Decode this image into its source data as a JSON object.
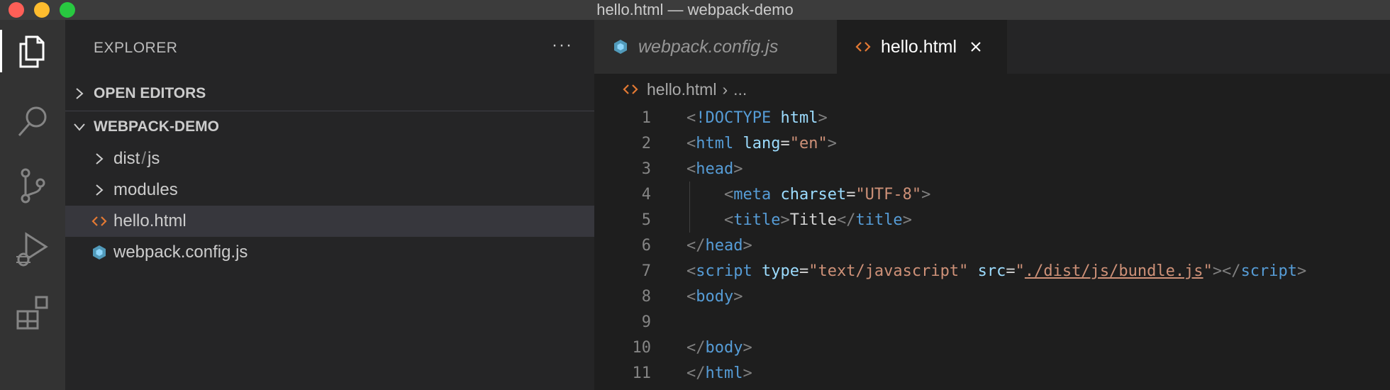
{
  "window": {
    "title": "hello.html — webpack-demo"
  },
  "colors": {
    "accent_orange": "#e37933",
    "js_config_blue": "#519aba",
    "tag_blue": "#569cd6",
    "attr_cyan": "#9cdcfe",
    "string_orange": "#ce9178"
  },
  "activity_bar": [
    {
      "name": "explorer",
      "icon": "files-icon",
      "active": true
    },
    {
      "name": "search",
      "icon": "search-icon"
    },
    {
      "name": "source-control",
      "icon": "source-control-icon"
    },
    {
      "name": "run-debug",
      "icon": "debug-icon"
    },
    {
      "name": "extensions",
      "icon": "extensions-icon"
    }
  ],
  "sidebar": {
    "header": "EXPLORER",
    "more": "···",
    "open_editors": "OPEN EDITORS",
    "project": "WEBPACK-DEMO",
    "tree": {
      "dist": "dist",
      "dist_sep": "/",
      "dist_child": "js",
      "modules": "modules",
      "hello": "hello.html",
      "webpack_config": "webpack.config.js"
    }
  },
  "tabs": {
    "webpack": "webpack.config.js",
    "hello": "hello.html"
  },
  "breadcrumb": {
    "file": "hello.html",
    "sep": "›",
    "rest": "..."
  },
  "editor": {
    "line_numbers": [
      "1",
      "2",
      "3",
      "4",
      "5",
      "6",
      "7",
      "8",
      "9",
      "10",
      "11"
    ],
    "lines": [
      [
        [
          "punct",
          "<"
        ],
        [
          "doctype",
          "!DOCTYPE"
        ],
        [
          "text",
          " "
        ],
        [
          "attr",
          "html"
        ],
        [
          "punct",
          ">"
        ]
      ],
      [
        [
          "punct",
          "<"
        ],
        [
          "tag",
          "html"
        ],
        [
          "text",
          " "
        ],
        [
          "attr",
          "lang"
        ],
        [
          "text",
          "="
        ],
        [
          "str",
          "\"en\""
        ],
        [
          "punct",
          ">"
        ]
      ],
      [
        [
          "punct",
          "<"
        ],
        [
          "tag",
          "head"
        ],
        [
          "punct",
          ">"
        ]
      ],
      [
        [
          "text",
          "    "
        ],
        [
          "punct",
          "<"
        ],
        [
          "tag",
          "meta"
        ],
        [
          "text",
          " "
        ],
        [
          "attr",
          "charset"
        ],
        [
          "text",
          "="
        ],
        [
          "str",
          "\"UTF-8\""
        ],
        [
          "punct",
          ">"
        ]
      ],
      [
        [
          "text",
          "    "
        ],
        [
          "punct",
          "<"
        ],
        [
          "tag",
          "title"
        ],
        [
          "punct",
          ">"
        ],
        [
          "text",
          "Title"
        ],
        [
          "punct",
          "</"
        ],
        [
          "tag",
          "title"
        ],
        [
          "punct",
          ">"
        ]
      ],
      [
        [
          "punct",
          "</"
        ],
        [
          "tag",
          "head"
        ],
        [
          "punct",
          ">"
        ]
      ],
      [
        [
          "punct",
          "<"
        ],
        [
          "tag",
          "script"
        ],
        [
          "text",
          " "
        ],
        [
          "attr",
          "type"
        ],
        [
          "text",
          "="
        ],
        [
          "str",
          "\"text/javascript\""
        ],
        [
          "text",
          " "
        ],
        [
          "attr",
          "src"
        ],
        [
          "text",
          "="
        ],
        [
          "str",
          "\""
        ],
        [
          "url",
          "./dist/js/bundle.js"
        ],
        [
          "str",
          "\""
        ],
        [
          "punct",
          "></"
        ],
        [
          "tag",
          "script"
        ],
        [
          "punct",
          ">"
        ]
      ],
      [
        [
          "punct",
          "<"
        ],
        [
          "tag",
          "body"
        ],
        [
          "punct",
          ">"
        ]
      ],
      [
        [
          "text",
          ""
        ]
      ],
      [
        [
          "punct",
          "</"
        ],
        [
          "tag",
          "body"
        ],
        [
          "punct",
          ">"
        ]
      ],
      [
        [
          "punct",
          "</"
        ],
        [
          "tag",
          "html"
        ],
        [
          "punct",
          ">"
        ]
      ]
    ]
  }
}
